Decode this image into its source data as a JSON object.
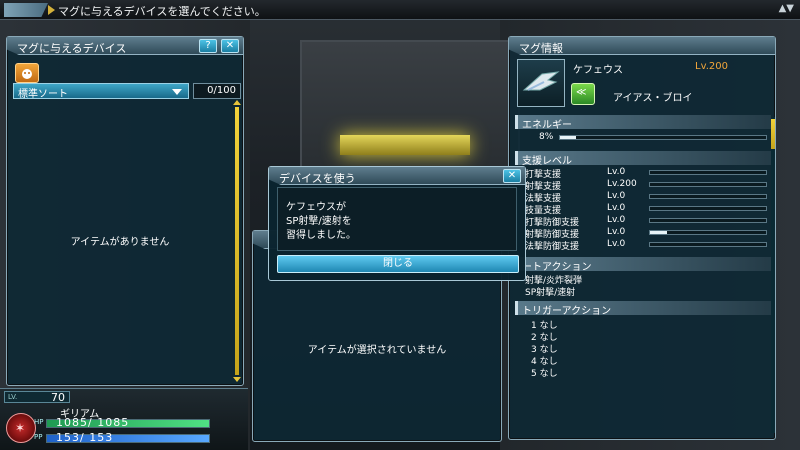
{
  "topbar": {
    "message": "マグに与えるデバイスを選んでください。",
    "arrows": "▲▼"
  },
  "left_panel": {
    "title": "マグに与えるデバイス",
    "help_label": "?",
    "close_label": "✕",
    "sort_label": "標準ソート",
    "count": "0/100",
    "empty_text": "アイテムがありません"
  },
  "status": {
    "lv_key": "LV.",
    "level": "70",
    "name": "ギリアム",
    "hp_key": "HP",
    "hp": "1085/ 1085",
    "hp_ratio": 1.0,
    "pp_key": "PP",
    "pp": "153/ 153",
    "pp_ratio": 1.0
  },
  "middle_panel": {
    "empty_text": "アイテムが選択されていません"
  },
  "dialog": {
    "title": "デバイスを使う",
    "close_icon": "✕",
    "lines": [
      "ケフェウスが",
      "SP射撃/速射を",
      "習得しました。"
    ],
    "button_label": "閉じる"
  },
  "mag": {
    "panel_title": "マグ情報",
    "name": "ケフェウス",
    "level": "Lv.200",
    "photon_blast": "アイアス・ブロイ",
    "energy_title": "エネルギー",
    "energy_pct": "8%",
    "energy_ratio": 0.08,
    "support_title": "支援レベル",
    "stats": [
      {
        "name": "打撃支援",
        "level": "Lv.0",
        "ratio": 0.0
      },
      {
        "name": "射撃支援",
        "level": "Lv.200",
        "ratio": 0.0
      },
      {
        "name": "法撃支援",
        "level": "Lv.0",
        "ratio": 0.0
      },
      {
        "name": "技量支援",
        "level": "Lv.0",
        "ratio": 0.0
      },
      {
        "name": "打撃防御支援",
        "level": "Lv.0",
        "ratio": 0.0
      },
      {
        "name": "射撃防御支援",
        "level": "Lv.0",
        "ratio": 0.15
      },
      {
        "name": "法撃防御支援",
        "level": "Lv.0",
        "ratio": 0.0
      }
    ],
    "auto_title": "ートアクション",
    "auto_actions": [
      "射撃/炎炸裂弾",
      "SP射撃/速射"
    ],
    "trigger_title": "トリガーアクション",
    "triggers": [
      "1 なし",
      "2 なし",
      "3 なし",
      "4 なし",
      "5 なし"
    ]
  }
}
